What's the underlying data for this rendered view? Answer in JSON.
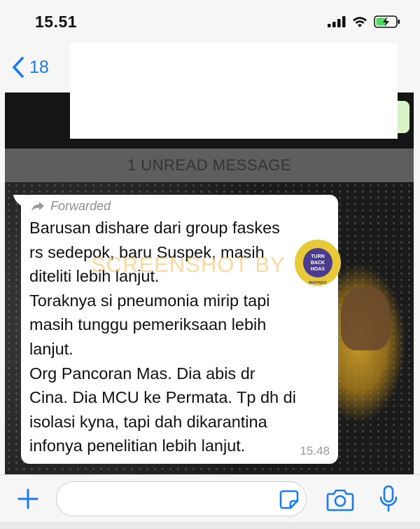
{
  "status_bar": {
    "time": "15.51",
    "icons": [
      "signal-icon",
      "wifi-icon",
      "battery-charging-icon"
    ]
  },
  "nav": {
    "back_count": "18",
    "back_icon": "chevron-left-icon"
  },
  "chat": {
    "unread_label": "1 UNREAD MESSAGE",
    "message": {
      "forwarded_label": "Forwarded",
      "text": "Barusan dishare dari group faskes\nrs sedepok, baru Suspek, masih\nditeliti lebih lanjut.\nToraknya si pneumonia mirip tapi\nmasih tunggu pemeriksaan lebih\nlanjut.\nOrg Pancoran Mas. Dia abis dr\nCina. Dia MCU ke Permata. Tp dh di\nisolasi kyna, tapi dah dikarantina\ninfonya penelitian lebih lanjut.",
      "time": "15.48"
    }
  },
  "overlay": {
    "watermark": "SCREENSHOT BY",
    "badge_main": "TURN BACK HOAX",
    "badge_line1": "TURN",
    "badge_line2": "BACK",
    "badge_line3": "HOAX",
    "badge_ring": "MASYARAKAT ANTI FITNAH INDONESIA",
    "badge_bottom": "MAFINDO"
  },
  "input": {
    "placeholder": "",
    "buttons": [
      "plus-icon",
      "sticker-icon",
      "camera-icon",
      "microphone-icon"
    ]
  },
  "colors": {
    "accent": "#1a7cf2",
    "bubble": "#ffffff",
    "unread_bar": "#5e5e5e",
    "badge_fill": "#e8c93a",
    "badge_inner": "#4a3c8c"
  }
}
